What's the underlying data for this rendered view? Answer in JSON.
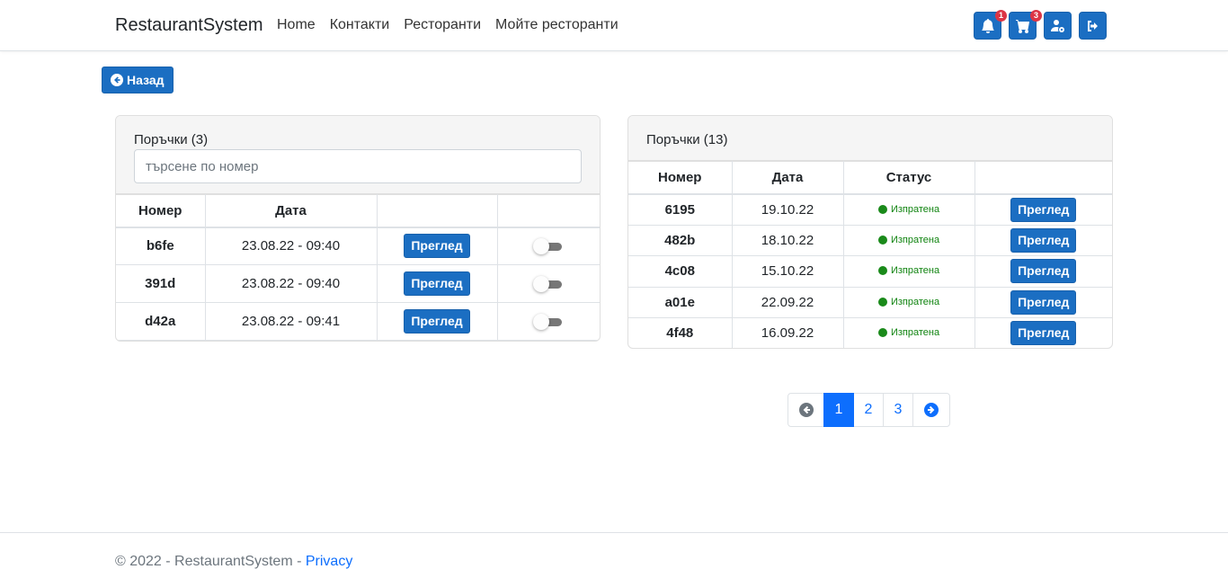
{
  "navbar": {
    "brand": "RestaurantSystem",
    "links": [
      "Home",
      "Контакти",
      "Ресторанти",
      "Мойте ресторанти"
    ],
    "notifications_count": "1",
    "cart_count": "3",
    "icons": [
      "bell-icon",
      "cart-icon",
      "user-gear-icon",
      "logout-icon"
    ]
  },
  "back_button": {
    "label": "Назад",
    "icon": "arrow-left-circle-icon"
  },
  "left_card": {
    "title": "Поръчки (3)",
    "search_placeholder": "търсене по номер",
    "columns": [
      "Номер",
      "Дата",
      "",
      ""
    ],
    "rows": [
      {
        "number": "b6fe",
        "date": "23.08.22 - 09:40",
        "action": "Преглед",
        "toggle_on": false
      },
      {
        "number": "391d",
        "date": "23.08.22 - 09:40",
        "action": "Преглед",
        "toggle_on": false
      },
      {
        "number": "d42a",
        "date": "23.08.22 - 09:41",
        "action": "Преглед",
        "toggle_on": false
      }
    ]
  },
  "right_card": {
    "title": "Поръчки (13)",
    "columns": [
      "Номер",
      "Дата",
      "Статус",
      ""
    ],
    "rows": [
      {
        "number": "6195",
        "date": "19.10.22",
        "status": "Изпратена",
        "action": "Преглед"
      },
      {
        "number": "482b",
        "date": "18.10.22",
        "status": "Изпратена",
        "action": "Преглед"
      },
      {
        "number": "4c08",
        "date": "15.10.22",
        "status": "Изпратена",
        "action": "Преглед"
      },
      {
        "number": "a01e",
        "date": "22.09.22",
        "status": "Изпратена",
        "action": "Преглед"
      },
      {
        "number": "4f48",
        "date": "16.09.22",
        "status": "Изпратена",
        "action": "Преглед"
      }
    ]
  },
  "pagination": {
    "pages": [
      "1",
      "2",
      "3"
    ],
    "current": "1"
  },
  "footer": {
    "text": "© 2022 - RestaurantSystem - ",
    "link": "Privacy"
  },
  "colors": {
    "primary": "#1b6ec2",
    "active_page": "#0d6efd",
    "status_green": "#118411",
    "badge_red": "#dc3545"
  }
}
